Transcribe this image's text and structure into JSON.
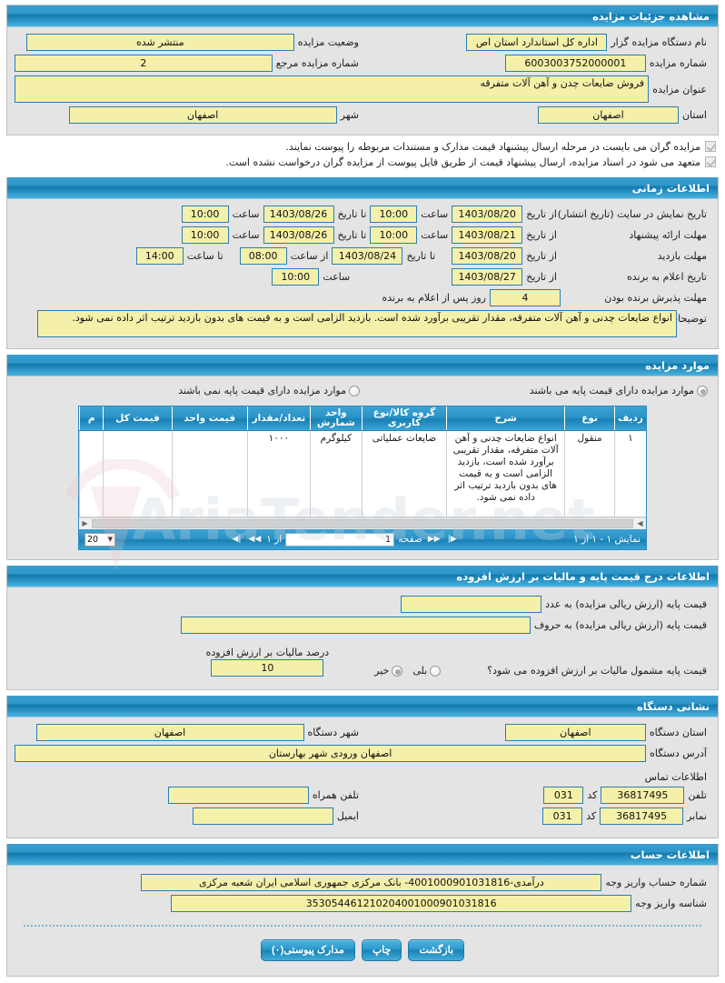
{
  "page": {
    "title": "مشاهده جزئیات مزایده"
  },
  "sections": {
    "details": {
      "header": "مشاهده جزئیات مزایده",
      "labels": {
        "org": "نام دستگاه مزایده گزار",
        "status": "وضعیت مزایده",
        "number": "شماره مزایده",
        "ref_number": "شماره مزایده مرجع",
        "subject": "عنوان مزایده",
        "province": "استان",
        "city": "شهر"
      },
      "values": {
        "org": "اداره کل استاندارد استان اص",
        "status": "منتشر شده",
        "number": "6003003752000001",
        "ref_number": "2",
        "subject": "فروش ضایعات چدن و آهن آلات متفرقه",
        "province": "اصفهان",
        "city": "اصفهان"
      },
      "notes": [
        "مزایده گران می بایست در مرحله ارسال پیشنهاد قیمت مدارک و مستندات مربوطه را پیوست نمایند.",
        "متعهد می شود در اسناد مزایده، ارسال پیشنهاد قیمت از طریق فایل پیوست از مزایده گران درخواست نشده است."
      ]
    },
    "time": {
      "header": "اطلاعات زمانی",
      "rows": [
        {
          "label": "تاریخ نمایش در سایت (تاریخ انتشار)",
          "from_label": "از تاریخ",
          "from_date": "1403/08/20",
          "from_time_label": "ساعت",
          "from_time": "10:00",
          "to_label": "تا تاریخ",
          "to_date": "1403/08/26",
          "to_time_label": "ساعت",
          "to_time": "10:00"
        },
        {
          "label": "مهلت ارائه پیشنهاد",
          "from_label": "از تاریخ",
          "from_date": "1403/08/21",
          "from_time_label": "ساعت",
          "from_time": "10:00",
          "to_label": "تا تاریخ",
          "to_date": "1403/08/26",
          "to_time_label": "ساعت",
          "to_time": "10:00"
        },
        {
          "label": "مهلت بازدید",
          "from_label": "از تاریخ",
          "from_date": "1403/08/20",
          "to_label": "تا تاریخ",
          "to_date": "1403/08/24",
          "from_time_label": "از ساعت",
          "from_time": "08:00",
          "to_time_label": "تا ساعت",
          "to_time": "14:00"
        }
      ],
      "winner": {
        "label": "تاریخ اعلام به برنده",
        "from_label": "از تاریخ",
        "date": "1403/08/27",
        "time_label": "ساعت",
        "time": "10:00"
      },
      "accept": {
        "label": "مهلت پذیرش برنده بودن",
        "value": "4",
        "suffix": "روز پس از اعلام به برنده"
      },
      "desc": {
        "label": "توضیحات",
        "value": "انواع ضایعات چدنی و آهن آلات متفرقه، مقدار تقریبی برآورد شده است. بازدید الزامی است و به قیمت های بدون بازدید ترتیب اثر داده نمی شود."
      }
    },
    "items": {
      "header": "موارد مزایده",
      "radio_with_base": "موارد مزایده دارای قیمت پایه می باشند",
      "radio_without_base": "موارد مزایده دارای قیمت پایه نمی باشند",
      "selected": "with_base",
      "columns": [
        "ردیف",
        "نوع",
        "شرح",
        "گروه کالا/نوع کاربری",
        "واحد شمارش",
        "تعداد/مقدار",
        "قیمت واحد",
        "قیمت کل",
        "م"
      ],
      "rows": [
        {
          "index": "۱",
          "type": "منقول",
          "desc": "انواع ضایعات چدنی و آهن آلات متفرقه، مقدار تقریبی برآورد شده است، بازدید الزامی است و به قیمت های بدون بازدید ترتیب اثر داده نمی شود.",
          "group": "ضایعات عملیاتی",
          "unit": "کیلوگرم",
          "qty": "۱۰۰۰",
          "unit_price": "",
          "total_price": "",
          "extra": ""
        }
      ],
      "pager": {
        "showing": "نمایش ۱ - ۱ از ۱",
        "page_label": "صفحه",
        "page_value": "1",
        "of_label": "از ۱",
        "page_size": "20"
      }
    },
    "base_price": {
      "header": "اطلاعات درج قیمت پایه و مالیات بر ارزش افزوده",
      "labels": {
        "numeric": "قیمت پایه (ارزش ریالی مزایده) به عدد",
        "words": "قیمت پایه (ارزش ریالی مزایده) به حروف",
        "vat_question": "قیمت پایه مشمول مالیات بر ارزش افزوده می شود؟",
        "vat_percent": "درصد مالیات بر ارزش افزوده"
      },
      "values": {
        "numeric": "",
        "words": "",
        "vat_percent": "10"
      },
      "vat_yes": "بلی",
      "vat_no": "خیر",
      "vat_selected": "no"
    },
    "address": {
      "header": "نشانی دستگاه",
      "labels": {
        "province": "استان دستگاه",
        "city": "شهر دستگاه",
        "address": "آدرس دستگاه",
        "contact_info": "اطلاعات تماس",
        "phone": "تلفن",
        "phone_code": "کد",
        "fax": "نمابر",
        "fax_code": "کد",
        "mobile": "تلفن همراه",
        "email": "ایمیل"
      },
      "values": {
        "province": "اصفهان",
        "city": "اصفهان",
        "address": "اصفهان ورودی شهر بهارستان",
        "phone": "36817495",
        "phone_code": "031",
        "fax": "36817495",
        "fax_code": "031",
        "mobile": "",
        "email": ""
      }
    },
    "account": {
      "header": "اطلاعات حساب",
      "labels": {
        "account_number": "شماره حساب واریز وجه",
        "payment_id": "شناسه واریز وجه"
      },
      "values": {
        "account_number": "درآمدی-4001000901031816- بانک مرکزی جمهوری اسلامی ایران شعبه مرکزی",
        "payment_id": "353054461210204001000901031816"
      }
    }
  },
  "buttons": {
    "attachments": "مدارک پیوستی(۰)",
    "print": "چاپ",
    "back": "بازگشت"
  },
  "watermark": {
    "text": "AriaTender.net"
  }
}
